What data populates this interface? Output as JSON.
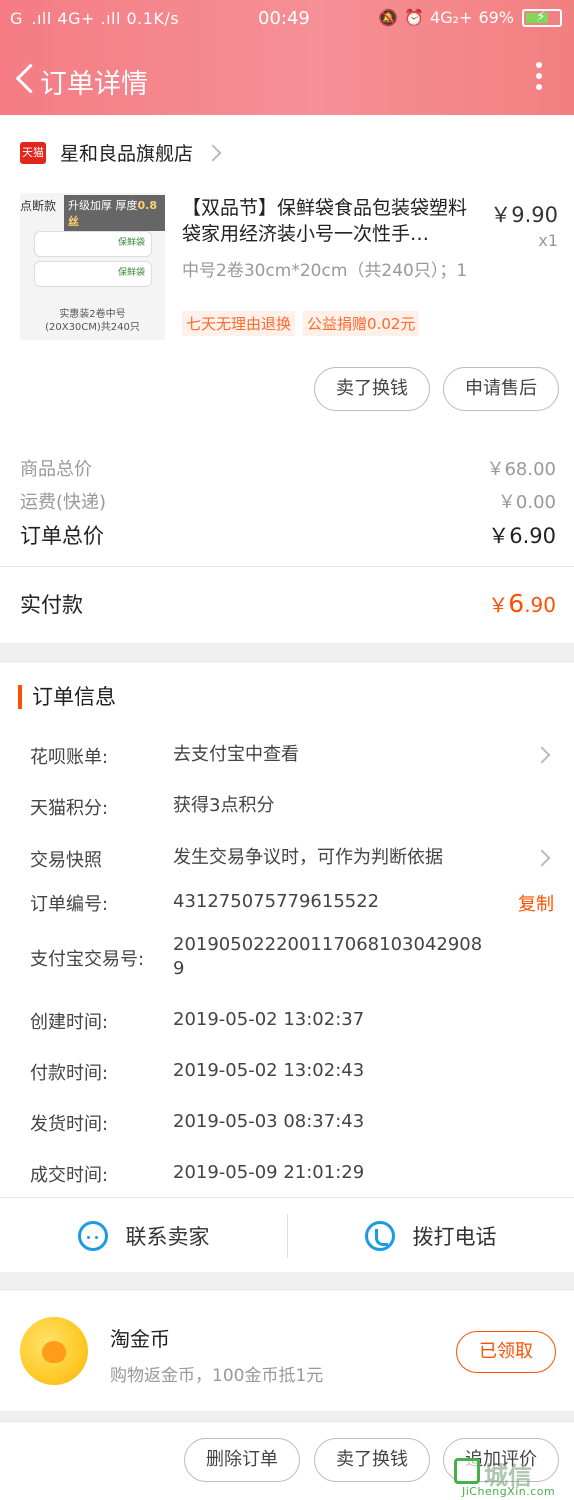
{
  "status_bar": {
    "left": "G .ıll 4G+ .ıll 0.1K/s",
    "time": "00:49",
    "network": "4G₂+",
    "battery": "69%"
  },
  "nav": {
    "title": "订单详情"
  },
  "store": {
    "logo_text": "天猫",
    "name": "星和良品旗舰店"
  },
  "product": {
    "image_badge": "点断款",
    "image_tag": "升级加厚 厚度",
    "image_tag_highlight": "0.8丝",
    "image_roll_label": "保鲜袋",
    "image_caption_1": "实惠装2卷中号",
    "image_caption_2": "(20X30CM)共240只",
    "title": "【双品节】保鲜袋食品包装袋塑料袋家用经济装小号一次性手…",
    "spec": "中号2卷30cm*20cm（共240只）；1",
    "tags": [
      "七天无理由退换",
      "公益捐赠0.02元"
    ],
    "price": "￥9.90",
    "qty": "x1",
    "btn_sell": "卖了换钱",
    "btn_aftersale": "申请售后"
  },
  "summary": {
    "goods_label": "商品总价",
    "goods_value": "￥68.00",
    "ship_label": "运费(快递)",
    "ship_value": "￥0.00",
    "total_label": "订单总价",
    "total_value": "￥6.90",
    "paid_label": "实付款",
    "paid_currency": "￥",
    "paid_int": "6",
    "paid_dec": ".90"
  },
  "order_info": {
    "title": "订单信息",
    "rows": [
      {
        "k": "花呗账单:",
        "v": "去支付宝中查看"
      },
      {
        "k": "天猫积分:",
        "v": "获得3点积分"
      },
      {
        "k": "交易快照",
        "v": "发生交易争议时，可作为判断依据"
      },
      {
        "k": "订单编号:",
        "v": "431275075779615522"
      },
      {
        "k": "支付宝交易号:",
        "v": "2019050222001170681030429089"
      },
      {
        "k": "创建时间:",
        "v": "2019-05-02 13:02:37"
      },
      {
        "k": "付款时间:",
        "v": "2019-05-02 13:02:43"
      },
      {
        "k": "发货时间:",
        "v": "2019-05-03 08:37:43"
      },
      {
        "k": "成交时间:",
        "v": "2019-05-09 21:01:29"
      }
    ],
    "copy_label": "复制",
    "contact_seller": "联系卖家",
    "call_phone": "拨打电话"
  },
  "coins": {
    "title": "淘金币",
    "subtitle": "购物返金币，100金币抵1元",
    "btn": "已领取"
  },
  "bottom_bar": {
    "delete": "删除订单",
    "sell": "卖了换钱",
    "evaluate": "追加评价"
  },
  "watermark": {
    "text": "城信",
    "site": "JiChengXin.com"
  }
}
